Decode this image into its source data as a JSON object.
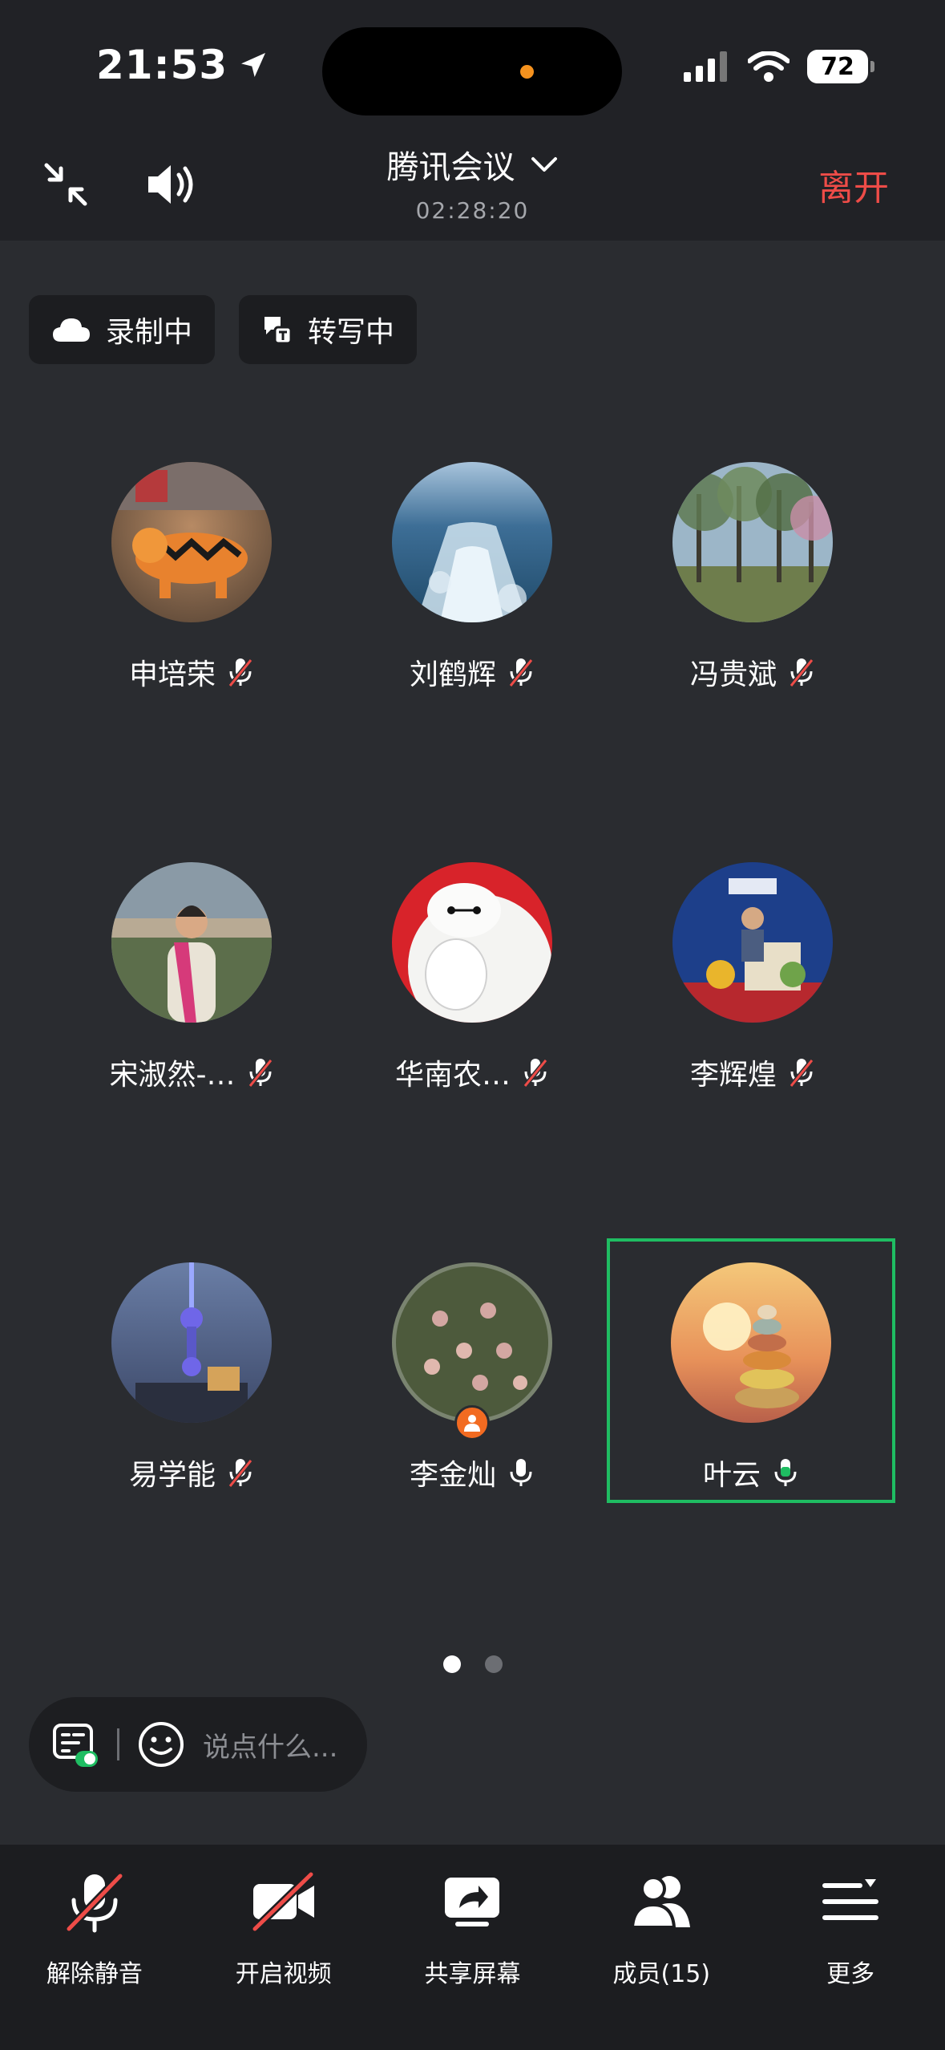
{
  "status_bar": {
    "time": "21:53",
    "battery": "72"
  },
  "header": {
    "title": "腾讯会议",
    "timer": "02:28:20",
    "leave_label": "离开"
  },
  "chips": [
    {
      "label": "录制中",
      "icon": "cloud-icon"
    },
    {
      "label": "转写中",
      "icon": "transcribe-icon"
    }
  ],
  "participants": [
    {
      "name": "申培荣",
      "mic": "muted",
      "avatar": "tiger-toy"
    },
    {
      "name": "刘鹤辉",
      "mic": "muted",
      "avatar": "ocean-wake"
    },
    {
      "name": "冯贵斌",
      "mic": "muted",
      "avatar": "trees"
    },
    {
      "name": "宋淑然-…",
      "mic": "muted",
      "avatar": "woman-photo"
    },
    {
      "name": "华南农…",
      "mic": "muted",
      "avatar": "baymax"
    },
    {
      "name": "李辉煌",
      "mic": "muted",
      "avatar": "forum-stage"
    },
    {
      "name": "易学能",
      "mic": "muted",
      "avatar": "tv-tower"
    },
    {
      "name": "李金灿",
      "mic": "on",
      "avatar": "fruit-tree",
      "host": true
    },
    {
      "name": "叶云",
      "mic": "speaking",
      "avatar": "stacked-stones",
      "active": true
    }
  ],
  "pagination": {
    "pages": 2,
    "current": 1
  },
  "chat": {
    "placeholder": "说点什么..."
  },
  "toolbar": [
    {
      "label": "解除静音",
      "icon": "mic-muted-icon"
    },
    {
      "label": "开启视频",
      "icon": "video-off-icon"
    },
    {
      "label": "共享屏幕",
      "icon": "share-screen-icon"
    },
    {
      "label": "成员(15)",
      "icon": "members-icon"
    },
    {
      "label": "更多",
      "icon": "more-icon"
    }
  ],
  "colors": {
    "accent_green": "#1fbd62",
    "leave_red": "#ee4c48",
    "host_orange": "#f26b21"
  }
}
